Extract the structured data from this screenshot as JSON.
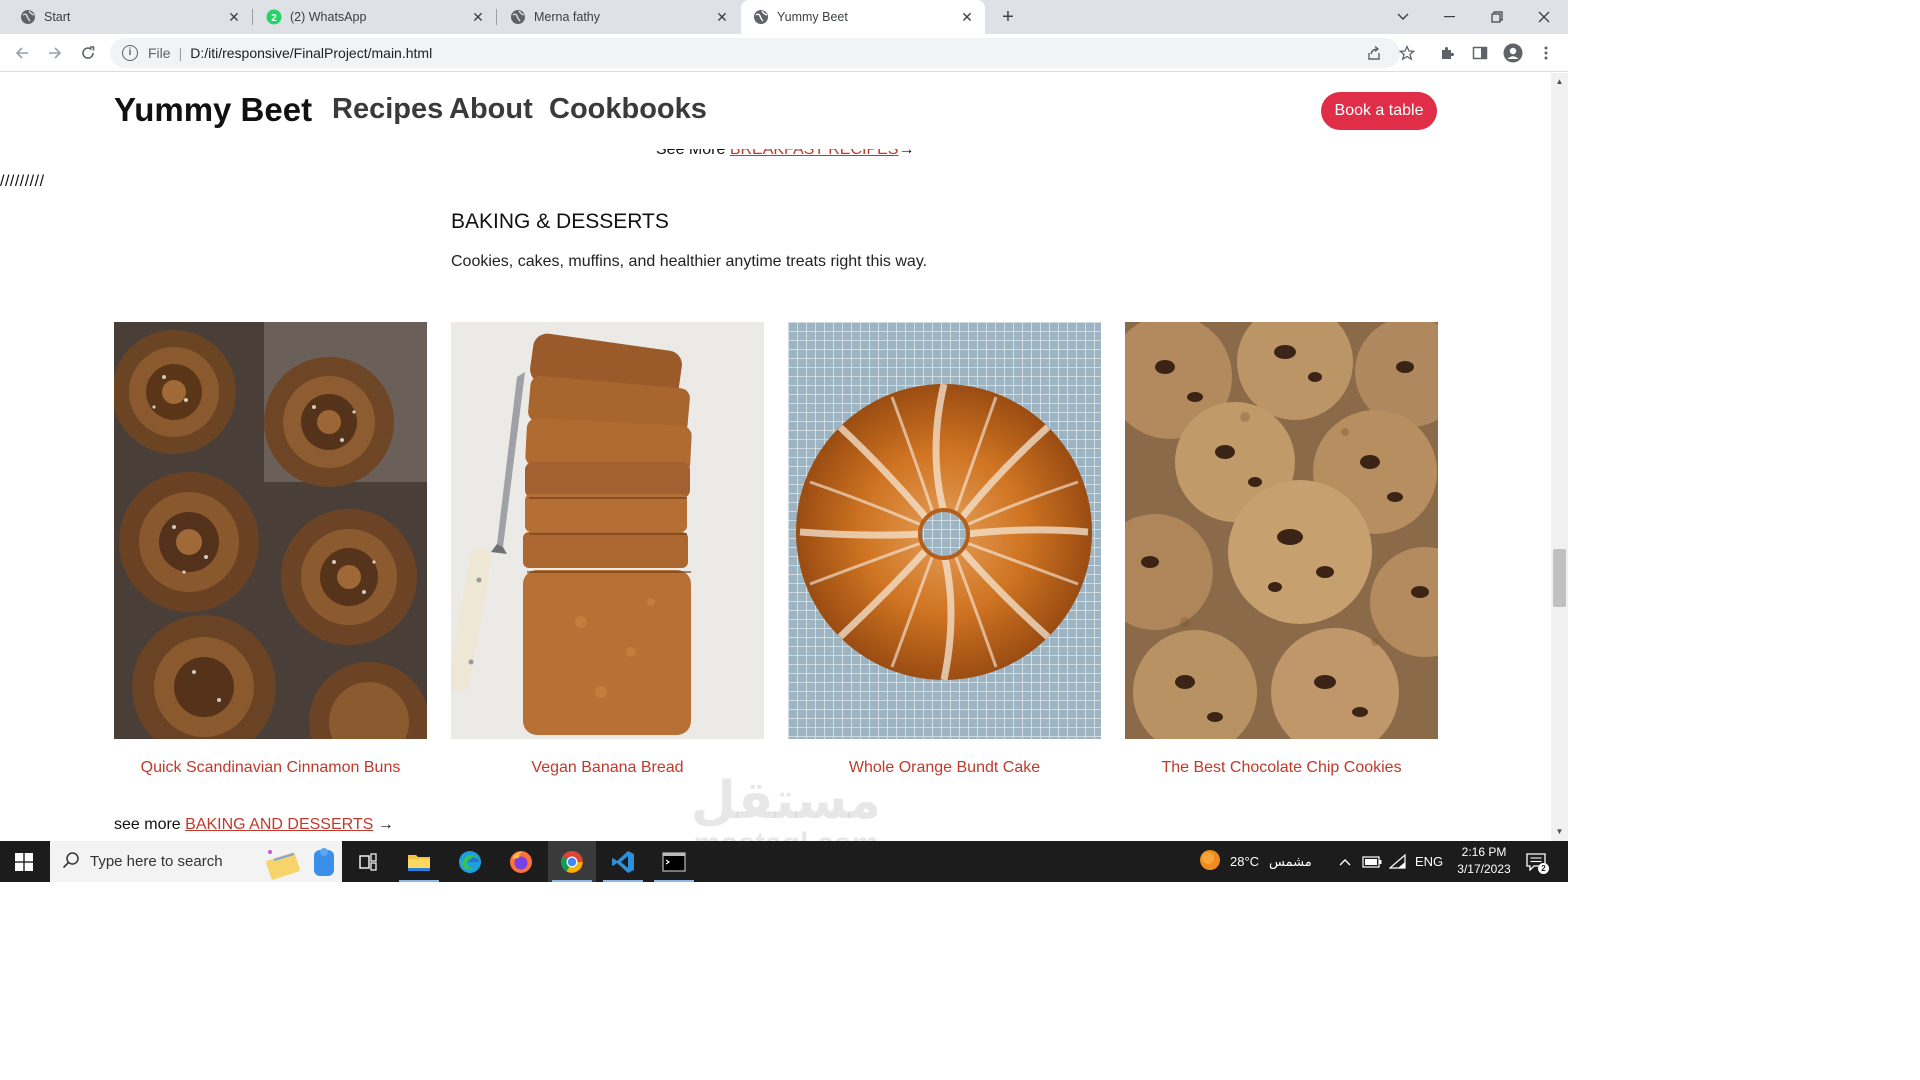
{
  "browser": {
    "tabs": [
      {
        "title": "Start",
        "active": false
      },
      {
        "title": "(2) WhatsApp",
        "active": false,
        "badge": "2"
      },
      {
        "title": "Merna fathy",
        "active": false
      },
      {
        "title": "Yummy Beet",
        "active": true
      }
    ],
    "omnibox": {
      "scheme": "File",
      "url": "D:/iti/responsive/FinalProject/main.html"
    }
  },
  "site": {
    "brand": "Yummy Beet",
    "nav": [
      "Recipes",
      "About",
      "Cookbooks"
    ],
    "cta": "Book a table",
    "breakfast_prefix": "See More ",
    "breakfast_link": "BREAKFAST RECIPES",
    "breakfast_arrow": "→",
    "slashes": "/////////",
    "section_title": "BAKING & DESSERTS",
    "section_desc": "Cookies, cakes, muffins, and healthier anytime treats right this way.",
    "recipes": [
      {
        "title": "Quick Scandinavian Cinnamon Buns"
      },
      {
        "title": "Vegan Banana Bread"
      },
      {
        "title": "Whole Orange Bundt Cake"
      },
      {
        "title": "The Best Chocolate Chip Cookies"
      }
    ],
    "see_more_prefix": "see more ",
    "see_more_link": "BAKING AND DESSERTS",
    "see_more_arrow": " →"
  },
  "watermark": {
    "arabic": "مستقل",
    "latin": "mostaql.com"
  },
  "taskbar": {
    "search_placeholder": "Type here to search",
    "weather": "28°C",
    "weather_label": "مشمس",
    "language": "ENG",
    "time": "2:16 PM",
    "date": "3/17/2023"
  },
  "colors": {
    "accent": "#e02e48",
    "link": "#c0392b",
    "taskbar": "#1c1c1c"
  }
}
